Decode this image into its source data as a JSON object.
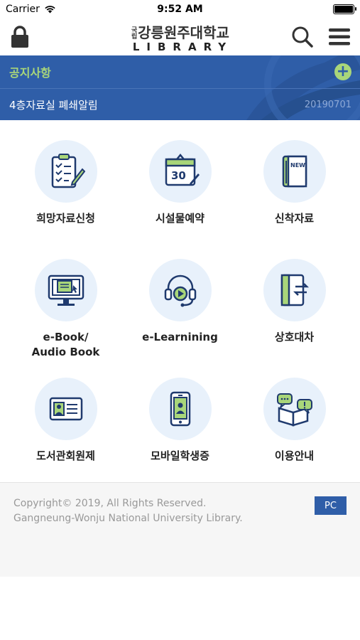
{
  "status_bar": {
    "carrier": "Carrier",
    "time": "9:52 AM"
  },
  "header": {
    "logo_small": "국립",
    "logo_korean": "강릉원주대학교",
    "logo_english": "LIBRARY",
    "icons": {
      "left": "lock-icon",
      "search": "search-icon",
      "menu": "hamburger-menu-icon"
    }
  },
  "notice": {
    "title": "공지사항",
    "item_text": "4층자료실 폐쇄알림",
    "item_date": "20190701"
  },
  "menu": {
    "items": [
      {
        "label": "희망자료신청",
        "icon": "request-checklist-icon"
      },
      {
        "label": "시설물예약",
        "icon": "calendar-30-icon"
      },
      {
        "label": "신착자료",
        "icon": "new-book-icon"
      },
      {
        "label1": "e-Book/",
        "label2": "Audio Book",
        "icon": "ebook-monitor-icon"
      },
      {
        "label": "e-Learnining",
        "icon": "headset-play-icon"
      },
      {
        "label": "상호대차",
        "icon": "book-exchange-icon"
      },
      {
        "label": "도서관회원제",
        "icon": "member-card-icon"
      },
      {
        "label": "모바일학생증",
        "icon": "mobile-id-icon"
      },
      {
        "label": "이용안내",
        "icon": "guide-chat-book-icon"
      }
    ]
  },
  "footer": {
    "copyright_line1": "Copyright© 2019, All Rights Reserved.",
    "copyright_line2": "Gangneung-Wonju National University Library.",
    "pc_button": "PC"
  },
  "colors": {
    "primary": "#2f5ea8",
    "accent_green": "#a9d67a",
    "icon_bg": "#e8f1fb",
    "icon_navy": "#1f3a6e"
  }
}
